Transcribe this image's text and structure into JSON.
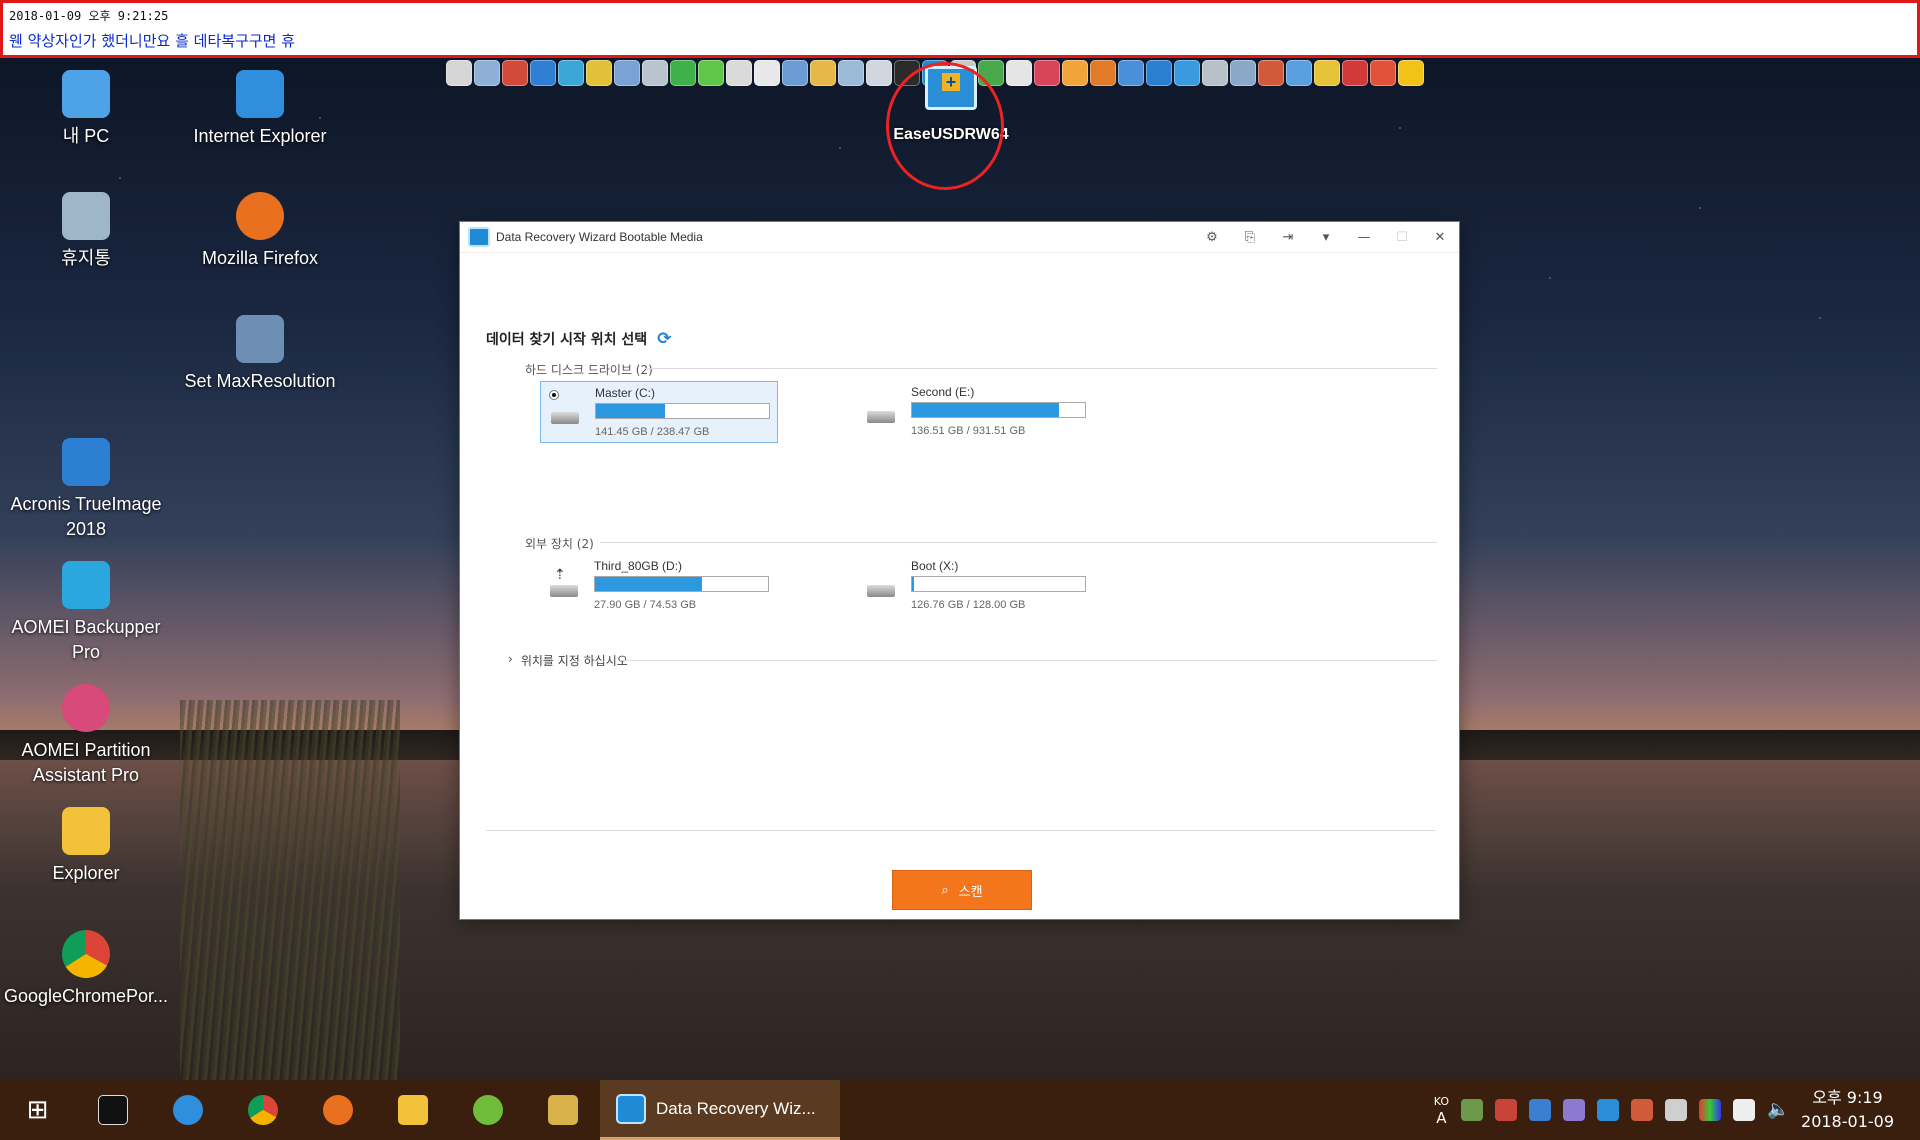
{
  "annotation": {
    "timestamp": "2018-01-09 오후 9:21:25",
    "message": "웬 약상자인가 했더니만요 흘 데타복구구면 휴"
  },
  "desktop_shortcut": {
    "label": "EaseUSDRW64",
    "icon": "easeus-drw-icon"
  },
  "desktop_icons": [
    {
      "label": "내 PC",
      "icon": "pc-icon",
      "color": "#4ea3e6"
    },
    {
      "label": "Internet Explorer",
      "icon": "internet-explorer-icon",
      "color": "#2f8fdc"
    },
    {
      "label": "휴지통",
      "icon": "recycle-bin-icon",
      "color": "#9fb6c8"
    },
    {
      "label": "Mozilla Firefox",
      "icon": "firefox-icon",
      "color": "#e8701e"
    },
    {
      "label": "Set MaxResolution",
      "icon": "monitor-icon",
      "color": "#6d8fb4"
    },
    {
      "label": "Acronis TrueImage 2018",
      "icon": "acronis-icon",
      "color": "#2c7fd2"
    },
    {
      "label": "AOMEI Backupper Pro",
      "icon": "aomei-backupper-icon",
      "color": "#2aa7df"
    },
    {
      "label": "AOMEI Partition Assistant Pro",
      "icon": "aomei-partition-icon",
      "color": "#d84a7a"
    },
    {
      "label": "Explorer",
      "icon": "folder-icon",
      "color": "#f2c23a"
    },
    {
      "label": "GoogleChromePor...",
      "icon": "chrome-icon",
      "color": "#db4437"
    }
  ],
  "window": {
    "title": "Data Recovery Wizard Bootable Media",
    "heading": "데이터 찾기 시작 위치 선택",
    "sections": [
      {
        "label": "하드 디스크 드라이브 (2)",
        "drives": [
          {
            "name": "Master (C:)",
            "size": "141.45 GB / 238.47 GB",
            "fill": 0.4,
            "selected": true,
            "icon": "hdd-icon"
          },
          {
            "name": "Second (E:)",
            "size": "136.51 GB / 931.51 GB",
            "fill": 0.85,
            "selected": false,
            "icon": "hdd-icon"
          }
        ]
      },
      {
        "label": "외부 장치 (2)",
        "drives": [
          {
            "name": "Third_80GB (D:)",
            "size": "27.90 GB / 74.53 GB",
            "fill": 0.62,
            "selected": false,
            "icon": "usb-drive-icon"
          },
          {
            "name": "Boot (X:)",
            "size": "126.76 GB / 128.00 GB",
            "fill": 0.01,
            "selected": false,
            "icon": "hdd-icon"
          }
        ]
      }
    ],
    "specify_location": "위치를 지정 하십시오",
    "scan_button": "스캔"
  },
  "taskbar": {
    "active_app": "Data Recovery Wiz...",
    "ime_top": "KO",
    "ime_bottom": "A",
    "clock_time": "오후 9:19",
    "clock_date": "2018-01-09"
  },
  "colors": {
    "accent": "#2b98e0",
    "scan_button": "#f3761c",
    "annotation_border": "#e21818",
    "annotation_text": "#0c2ad0",
    "taskbar": "#3a1f0e"
  }
}
